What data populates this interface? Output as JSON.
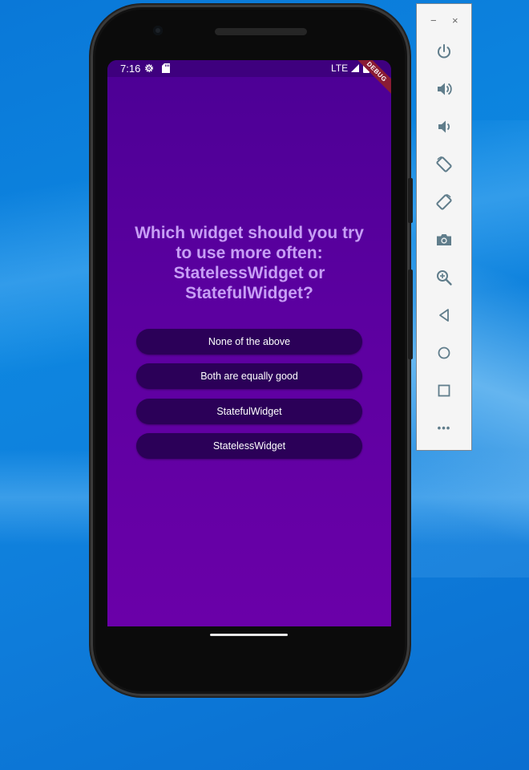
{
  "status_bar": {
    "time": "7:16",
    "network": "LTE",
    "debug_banner": "DEBUG"
  },
  "quiz": {
    "question": "Which widget should you try to use more often: StatelessWidget or StatefulWidget?",
    "answers": [
      "None of the above",
      "Both are equally good",
      "StatefulWidget",
      "StatelessWidget"
    ]
  },
  "emulator_toolbar": {
    "window_controls": [
      "−",
      "×"
    ],
    "more_label": "•••",
    "buttons": [
      "power-icon",
      "volume-up-icon",
      "volume-down-icon",
      "rotate-left-icon",
      "rotate-right-icon",
      "camera-icon",
      "zoom-icon",
      "back-icon",
      "home-icon",
      "overview-icon",
      "more-icon"
    ]
  },
  "colors": {
    "screen_top": "#4c0095",
    "screen_bottom": "#6a00a8",
    "question_text": "#c79ef5",
    "button_bg": "#2b0058",
    "toolbar_icon": "#607d8b"
  }
}
